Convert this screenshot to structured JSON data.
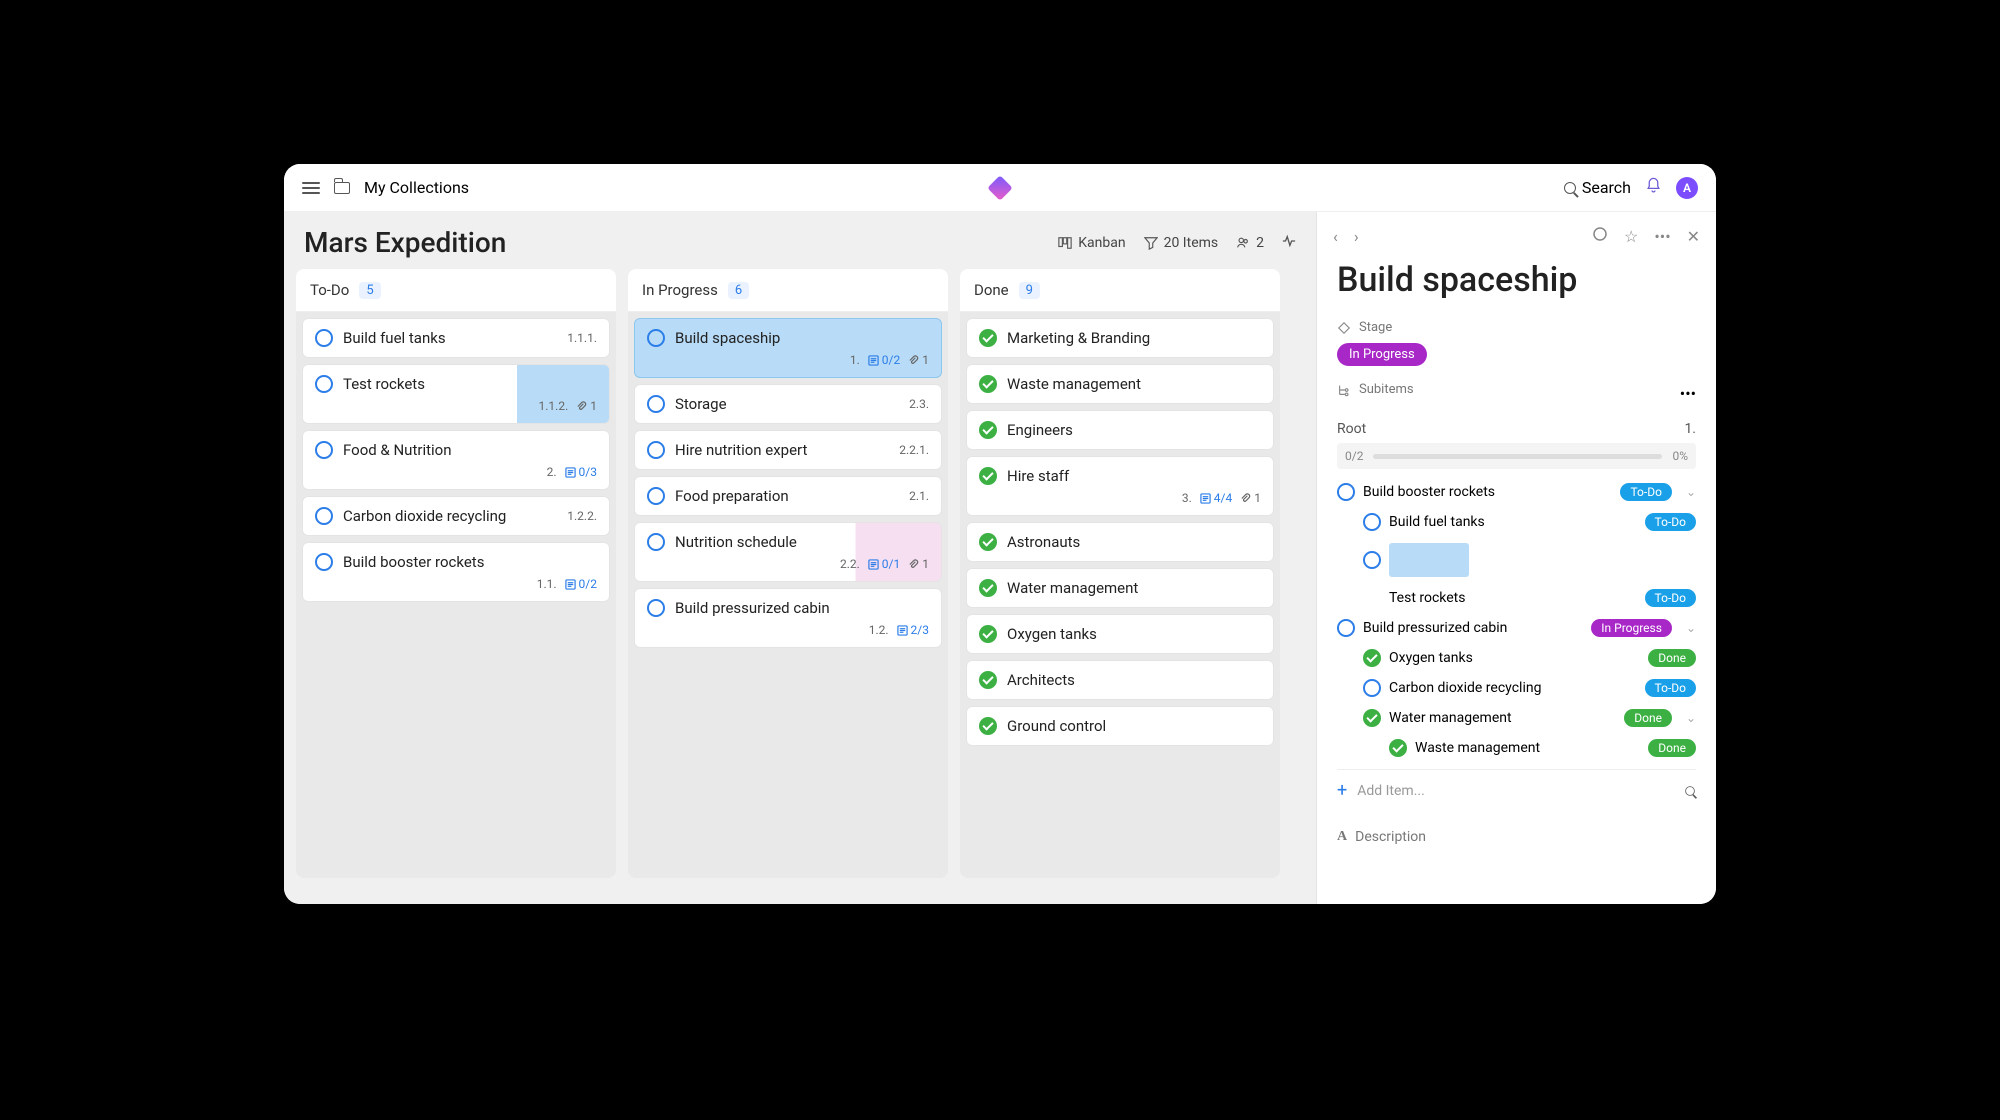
{
  "header": {
    "collections": "My Collections",
    "search": "Search",
    "avatar": "A"
  },
  "board": {
    "title": "Mars Expedition",
    "view": "Kanban",
    "items_count": "20 Items",
    "people": "2"
  },
  "columns": [
    {
      "name": "To-Do",
      "count": "5",
      "status": "todo",
      "cards": [
        {
          "title": "Build fuel tanks",
          "num": "1.1.1.",
          "status": "todo"
        },
        {
          "title": "Test rockets",
          "num": "1.1.2.",
          "attach": "1",
          "status": "todo",
          "thumb": "blue"
        },
        {
          "title": "Food & Nutrition",
          "num": "2.",
          "progress": "0/3",
          "status": "todo"
        },
        {
          "title": "Carbon dioxide recycling",
          "num": "1.2.2.",
          "status": "todo"
        },
        {
          "title": "Build booster rockets",
          "num": "1.1.",
          "progress": "0/2",
          "status": "todo"
        }
      ]
    },
    {
      "name": "In Progress",
      "count": "6",
      "status": "todo",
      "cards": [
        {
          "title": "Build spaceship",
          "num": "1.",
          "progress": "0/2",
          "attach": "1",
          "status": "todo",
          "selected": true
        },
        {
          "title": "Storage",
          "num": "2.3.",
          "status": "todo"
        },
        {
          "title": "Hire nutrition expert",
          "num": "2.2.1.",
          "status": "todo"
        },
        {
          "title": "Food preparation",
          "num": "2.1.",
          "status": "todo"
        },
        {
          "title": "Nutrition schedule",
          "num": "2.2.",
          "progress": "0/1",
          "attach": "1",
          "status": "todo",
          "thumb": "pink"
        },
        {
          "title": "Build pressurized cabin",
          "num": "1.2.",
          "progress": "2/3",
          "status": "todo"
        }
      ]
    },
    {
      "name": "Done",
      "count": "9",
      "status": "done",
      "cards": [
        {
          "title": "Marketing & Branding",
          "status": "done"
        },
        {
          "title": "Waste management",
          "status": "done"
        },
        {
          "title": "Engineers",
          "status": "done"
        },
        {
          "title": "Hire staff",
          "num": "3.",
          "progress": "4/4",
          "attach": "1",
          "status": "done"
        },
        {
          "title": "Astronauts",
          "status": "done"
        },
        {
          "title": "Water management",
          "status": "done"
        },
        {
          "title": "Oxygen tanks",
          "status": "done"
        },
        {
          "title": "Architects",
          "status": "done"
        },
        {
          "title": "Ground control",
          "status": "done"
        }
      ]
    }
  ],
  "detail": {
    "title": "Build spaceship",
    "stage_label": "Stage",
    "stage_value": "In Progress",
    "subitems_label": "Subitems",
    "root_label": "Root",
    "root_num": "1.",
    "progress_frac": "0/2",
    "progress_pct": "0%",
    "items": [
      {
        "level": 1,
        "title": "Build booster rockets",
        "pill": "To-Do",
        "pclass": "todo",
        "status": "todo",
        "chev": true
      },
      {
        "level": 2,
        "title": "Build fuel tanks",
        "pill": "To-Do",
        "pclass": "todo",
        "status": "todo"
      },
      {
        "level": 2,
        "thumb": true,
        "status": "todo"
      },
      {
        "level": 2,
        "title": "Test rockets",
        "pill": "To-Do",
        "pclass": "todo",
        "nocircle": true
      },
      {
        "level": 1,
        "title": "Build pressurized cabin",
        "pill": "In Progress",
        "pclass": "progress",
        "status": "todo",
        "chev": true
      },
      {
        "level": 2,
        "title": "Oxygen tanks",
        "pill": "Done",
        "pclass": "done",
        "status": "done"
      },
      {
        "level": 2,
        "title": "Carbon dioxide recycling",
        "pill": "To-Do",
        "pclass": "todo",
        "status": "todo"
      },
      {
        "level": 2,
        "title": "Water management",
        "pill": "Done",
        "pclass": "done",
        "status": "done",
        "chev": true
      },
      {
        "level": 3,
        "title": "Waste management",
        "pill": "Done",
        "pclass": "done",
        "status": "done"
      }
    ],
    "add_item": "Add Item...",
    "description_label": "Description"
  }
}
